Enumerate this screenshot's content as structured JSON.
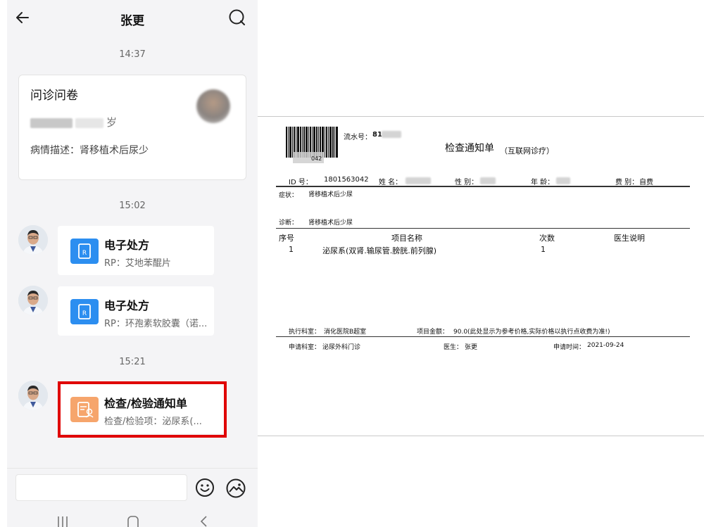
{
  "phone": {
    "header": {
      "title": "张更"
    },
    "times": [
      "14:37",
      "15:02",
      "15:21"
    ],
    "questionnaire": {
      "title": "问诊问卷",
      "age_suffix": "岁",
      "description": "病情描述：肾移植术后尿少"
    },
    "messages": [
      {
        "title": "电子处方",
        "subtitle": "RP：艾地苯醌片"
      },
      {
        "title": "电子处方",
        "subtitle": "RP：环孢素软胶囊（诺..."
      },
      {
        "title": "检查/检验通知单",
        "subtitle": "检查/检验项：泌尿系(..."
      }
    ],
    "icons": {
      "back": "back-arrow-icon",
      "search": "search-icon",
      "emoji": "emoji-icon",
      "image": "image-icon"
    },
    "highlight_color": "#e00000"
  },
  "document": {
    "serial_label": "流水号：",
    "serial_value": "81",
    "barcode_number_tail": "042",
    "title": "检查通知单",
    "title_suffix": "（互联网诊疗）",
    "info": {
      "id_label": "ID 号：",
      "id_value": "1801563042",
      "name_label": "姓 名：",
      "sex_label": "性 别：",
      "age_label": "年 龄：",
      "fee_label": "费 别：",
      "fee_value": "自费"
    },
    "symptom_label": "症状：",
    "symptom_value": "肾移植术后少尿",
    "diagnosis_label": "诊断：",
    "diagnosis_value": "肾移植术后少尿",
    "table_headers": [
      "序号",
      "项目名称",
      "次数",
      "医生说明"
    ],
    "rows": [
      {
        "index": "1",
        "name": "泌尿系(双肾.输尿管.膀胱.前列腺)",
        "count": "1",
        "note": ""
      }
    ],
    "exec_dept_label": "执行科室：",
    "exec_dept_value": "消化医院B超室",
    "amount_label": "项目金额：",
    "amount_value": "90.0(此处显示为参考价格,实际价格以执行点收费为准!)",
    "apply_dept_label": "申请科室：",
    "apply_dept_value": "泌尿外科门诊",
    "doctor_label": "医生：",
    "doctor_value": "张更",
    "apply_time_label": "申请时间：",
    "apply_time_value": "2021-09-24"
  }
}
